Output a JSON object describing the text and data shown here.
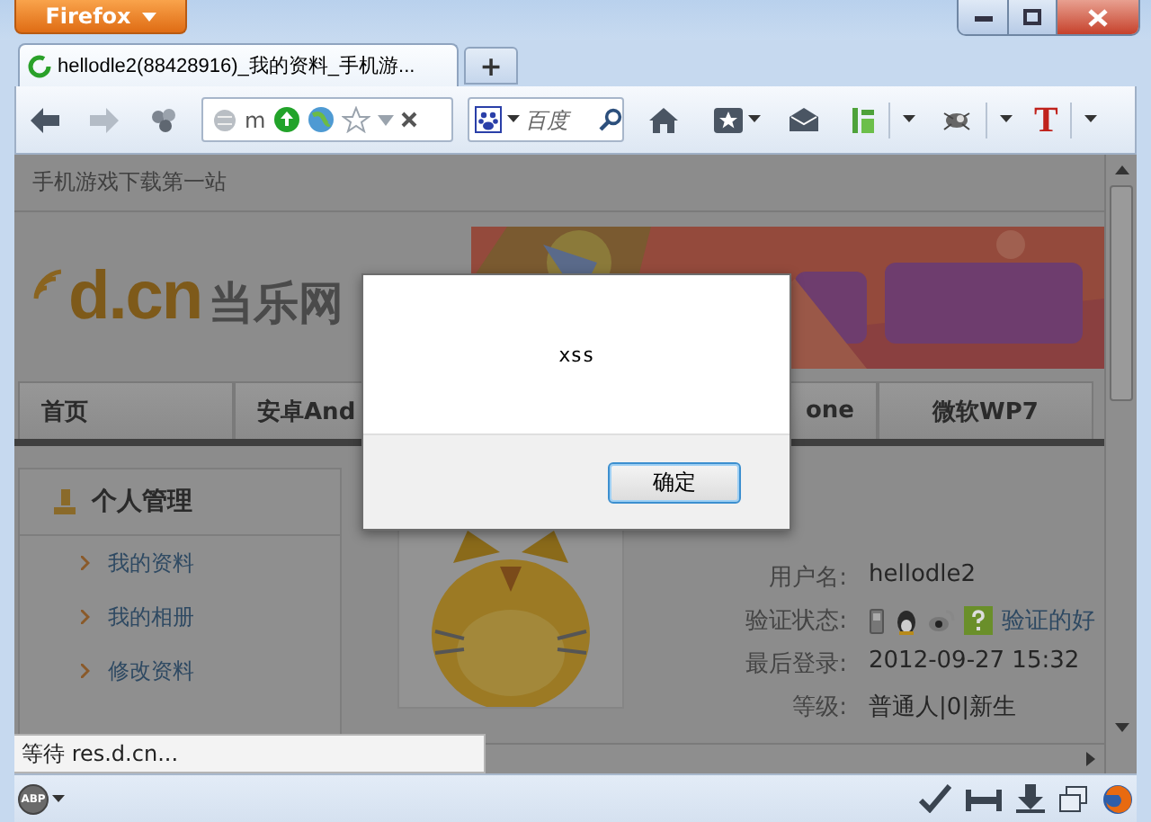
{
  "window": {
    "app_button": "Firefox"
  },
  "tabs": [
    {
      "title": "hellodle2(88428916)_我的资料_手机游...",
      "selected": true,
      "loading": true
    }
  ],
  "new_tab_button": "+",
  "navigation": {
    "back_disabled": false,
    "forward_disabled": true
  },
  "address_bar": {
    "value": "m",
    "starred": false
  },
  "search": {
    "placeholder": "百度"
  },
  "toolbar_letter_icon": "T",
  "page": {
    "tagline": "手机游戏下载第一站",
    "logo": {
      "domain": "d.cn",
      "name": "当乐网"
    },
    "nav_tabs": [
      {
        "label": "首页",
        "kind": "left"
      },
      {
        "label": "安卓And",
        "kind": "left"
      },
      {
        "label": "one",
        "kind": "right"
      },
      {
        "label": "微软WP7",
        "kind": "center"
      }
    ],
    "sidebar": {
      "title": "个人管理",
      "items": [
        "我的资料",
        "我的相册",
        "修改资料"
      ]
    },
    "profile": [
      {
        "label": "用户名:",
        "value": "hellodle2",
        "kind": "text"
      },
      {
        "label": "验证状态:",
        "value": "验证的好",
        "kind": "badges"
      },
      {
        "label": "最后登录:",
        "value": "2012-09-27 15:32",
        "kind": "text"
      },
      {
        "label": "等级:",
        "value": "普通人|0|新生",
        "kind": "text"
      }
    ]
  },
  "dialog": {
    "message": "xss",
    "button": "确定"
  },
  "status": "等待 res.d.cn...",
  "addon_bar": {
    "abp_label": "ABP"
  }
}
